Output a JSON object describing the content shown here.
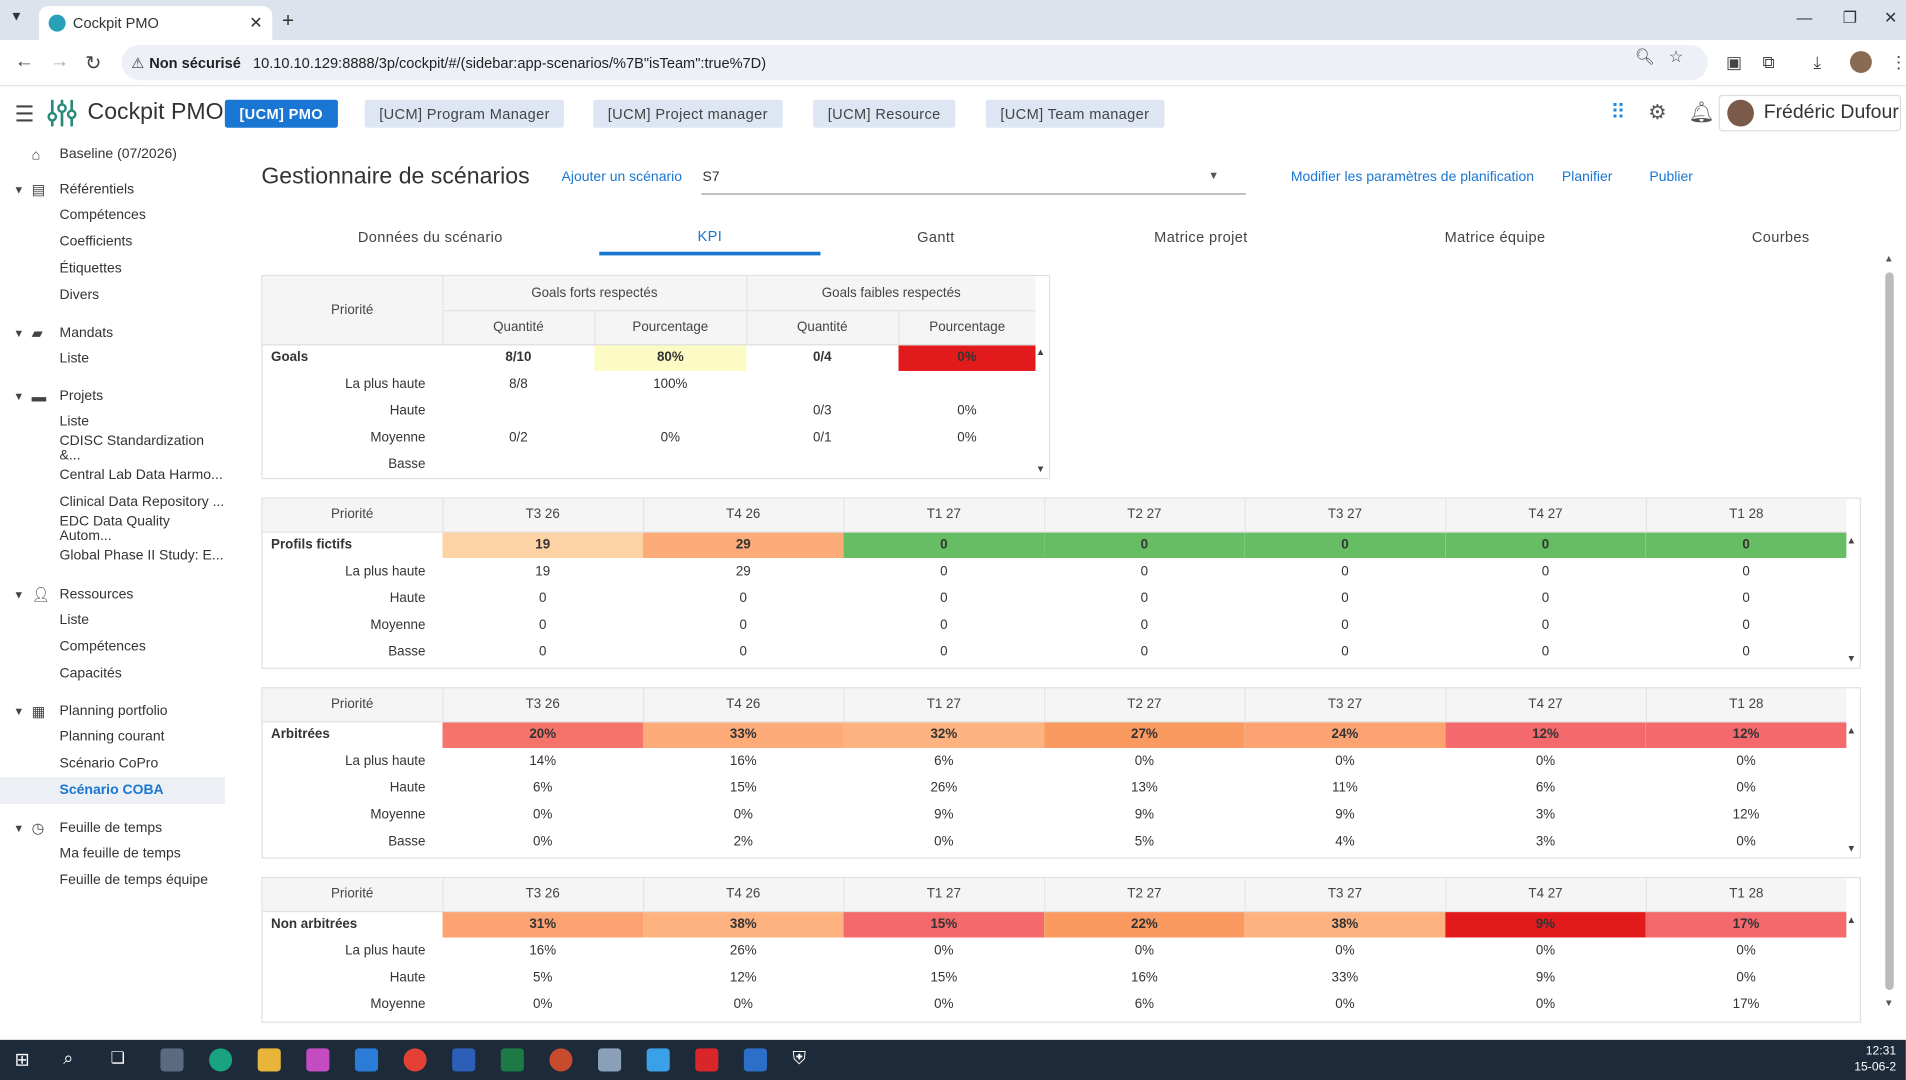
{
  "browser": {
    "tab_title": "Cockpit PMO",
    "not_secure": "Non sécurisé",
    "url": "10.10.10.129:8888/3p/cockpit/#/(sidebar:app-scenarios/%7B\"isTeam\":true%7D)"
  },
  "header": {
    "app_title": "Cockpit PMO",
    "roles": [
      "[UCM] PMO",
      "[UCM] Program Manager",
      "[UCM] Project manager",
      "[UCM] Resource",
      "[UCM] Team manager"
    ],
    "user_name": "Frédéric Dufour"
  },
  "sidebar": {
    "baseline": "Baseline (07/2026)",
    "referentiels": {
      "label": "Référentiels",
      "items": [
        "Compétences",
        "Coefficients",
        "Étiquettes",
        "Divers"
      ]
    },
    "mandats": {
      "label": "Mandats",
      "items": [
        "Liste"
      ]
    },
    "projets": {
      "label": "Projets",
      "items": [
        "Liste",
        "CDISC Standardization &...",
        "Central Lab Data Harmo...",
        "Clinical Data Repository ...",
        "EDC Data Quality Autom...",
        "Global Phase II Study: E..."
      ]
    },
    "ressources": {
      "label": "Ressources",
      "items": [
        "Liste",
        "Compétences",
        "Capacités"
      ]
    },
    "planning": {
      "label": "Planning portfolio",
      "items": [
        "Planning courant",
        "Scénario CoPro",
        "Scénario COBA"
      ]
    },
    "feuille": {
      "label": "Feuille de temps",
      "items": [
        "Ma feuille de temps",
        "Feuille de temps équipe"
      ]
    }
  },
  "main": {
    "title": "Gestionnaire de scénarios",
    "add_scenario": "Ajouter un scénario",
    "scenario_selected": "S7",
    "modify_params": "Modifier les paramètres de planification",
    "plan": "Planifier",
    "publish": "Publier",
    "tabs": [
      "Données du scénario",
      "KPI",
      "Gantt",
      "Matrice projet",
      "Matrice équipe",
      "Courbes"
    ]
  },
  "goals_table": {
    "priority_header": "Priorité",
    "group_strong": "Goals forts respectés",
    "group_weak": "Goals faibles respectés",
    "sub_headers": [
      "Quantité",
      "Pourcentage",
      "Quantité",
      "Pourcentage"
    ],
    "rows": [
      {
        "label": "Goals",
        "cells": [
          "8/10",
          "80%",
          "0/4",
          "0%"
        ]
      },
      {
        "label": "La plus haute",
        "cells": [
          "8/8",
          "100%",
          "",
          ""
        ]
      },
      {
        "label": "Haute",
        "cells": [
          "",
          "",
          "0/3",
          "0%"
        ]
      },
      {
        "label": "Moyenne",
        "cells": [
          "0/2",
          "0%",
          "0/1",
          "0%"
        ]
      },
      {
        "label": "Basse",
        "cells": [
          "",
          "",
          "",
          ""
        ]
      }
    ],
    "total_colors": [
      "",
      "#fdfbc4",
      "",
      "#e31a1c"
    ]
  },
  "quarter_tables": [
    {
      "header": [
        "Priorité",
        "T3 26",
        "T4 26",
        "T1 27",
        "T2 27",
        "T3 27",
        "T4 27",
        "T1 28"
      ],
      "rows": [
        {
          "label": "Profils fictifs",
          "cells": [
            "19",
            "29",
            "0",
            "0",
            "0",
            "0",
            "0"
          ]
        },
        {
          "label": "La plus haute",
          "cells": [
            "19",
            "29",
            "0",
            "0",
            "0",
            "0",
            "0"
          ]
        },
        {
          "label": "Haute",
          "cells": [
            "0",
            "0",
            "0",
            "0",
            "0",
            "0",
            "0"
          ]
        },
        {
          "label": "Moyenne",
          "cells": [
            "0",
            "0",
            "0",
            "0",
            "0",
            "0",
            "0"
          ]
        },
        {
          "label": "Basse",
          "cells": [
            "0",
            "0",
            "0",
            "0",
            "0",
            "0",
            "0"
          ]
        }
      ],
      "total_colors": [
        "#fdd3a5",
        "#fcab79",
        "#66bd63",
        "#66bd63",
        "#66bd63",
        "#66bd63",
        "#66bd63"
      ]
    },
    {
      "header": [
        "Priorité",
        "T3 26",
        "T4 26",
        "T1 27",
        "T2 27",
        "T3 27",
        "T4 27",
        "T1 28"
      ],
      "rows": [
        {
          "label": "Arbitrées",
          "cells": [
            "20%",
            "33%",
            "32%",
            "27%",
            "24%",
            "12%",
            "12%"
          ]
        },
        {
          "label": "La plus haute",
          "cells": [
            "14%",
            "16%",
            "6%",
            "0%",
            "0%",
            "0%",
            "0%"
          ]
        },
        {
          "label": "Haute",
          "cells": [
            "6%",
            "15%",
            "26%",
            "13%",
            "11%",
            "6%",
            "0%"
          ]
        },
        {
          "label": "Moyenne",
          "cells": [
            "0%",
            "0%",
            "9%",
            "9%",
            "9%",
            "3%",
            "12%"
          ]
        },
        {
          "label": "Basse",
          "cells": [
            "0%",
            "2%",
            "0%",
            "5%",
            "4%",
            "3%",
            "0%"
          ]
        }
      ],
      "total_colors": [
        "#f6736a",
        "#fcab79",
        "#fdb27f",
        "#fb9a60",
        "#fca471",
        "#f4696b",
        "#f4696b"
      ]
    },
    {
      "header": [
        "Priorité",
        "T3 26",
        "T4 26",
        "T1 27",
        "T2 27",
        "T3 27",
        "T4 27",
        "T1 28"
      ],
      "rows": [
        {
          "label": "Non arbitrées",
          "cells": [
            "31%",
            "38%",
            "15%",
            "22%",
            "38%",
            "9%",
            "17%"
          ]
        },
        {
          "label": "La plus haute",
          "cells": [
            "16%",
            "26%",
            "0%",
            "0%",
            "0%",
            "0%",
            "0%"
          ]
        },
        {
          "label": "Haute",
          "cells": [
            "5%",
            "12%",
            "15%",
            "16%",
            "33%",
            "9%",
            "0%"
          ]
        },
        {
          "label": "Moyenne",
          "cells": [
            "0%",
            "0%",
            "0%",
            "6%",
            "0%",
            "0%",
            "17%"
          ]
        }
      ],
      "total_colors": [
        "#fca471",
        "#fdb27f",
        "#f4696b",
        "#fb9a60",
        "#fdb27f",
        "#e31a1c",
        "#f4696b"
      ]
    }
  ],
  "taskbar": {
    "time": "12:31",
    "date": "15-06-2"
  }
}
